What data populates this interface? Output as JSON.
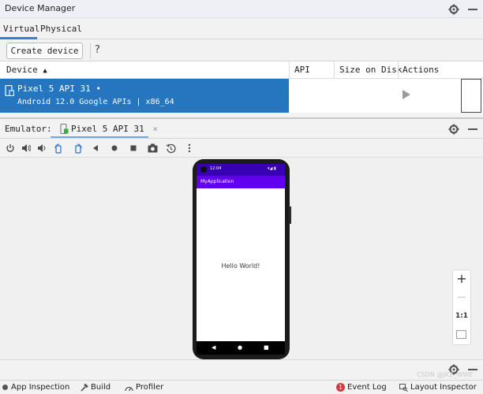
{
  "device_manager": {
    "title": "Device Manager",
    "tabs": [
      "Virtual",
      "Physical"
    ],
    "create_device_label": "Create device",
    "help_label": "?",
    "columns": [
      "Device",
      "API",
      "Size on Disk",
      "Actions"
    ],
    "devices": [
      {
        "name": "Pixel 5 API 31 •",
        "details": "Android 12.0 Google APIs | x86_64",
        "api": "",
        "size_on_disk": ""
      }
    ]
  },
  "emulator": {
    "label": "Emulator:",
    "tab_label": "Pixel 5 API 31",
    "tab_close": "×",
    "phone": {
      "status_time": "12:04",
      "status_icons": "▾◢ ▮",
      "app_title": "MyApplication",
      "content_text": "Hello World!",
      "nav": [
        "◀",
        "●",
        "■"
      ]
    },
    "zoom": {
      "zoom_in": "+",
      "zoom_out": "—",
      "actual_size": "1:1"
    },
    "watermark": "CSDN @JKZ_WWE"
  },
  "bottom_bar": {
    "items": [
      {
        "label": "App Inspection",
        "icon": "app-inspection-icon"
      },
      {
        "label": "Build",
        "icon": "hammer-icon"
      },
      {
        "label": "Profiler",
        "icon": "gauge-icon"
      },
      {
        "label": "Event Log",
        "icon": "event-log-badge-icon",
        "badge": "1"
      },
      {
        "label": "Layout Inspector",
        "icon": "layout-inspector-icon"
      }
    ]
  },
  "colors": {
    "selection": "#2675bf",
    "status_bar": "#3700b3",
    "app_bar": "#6200ee",
    "accent": "#3b7ad9"
  }
}
